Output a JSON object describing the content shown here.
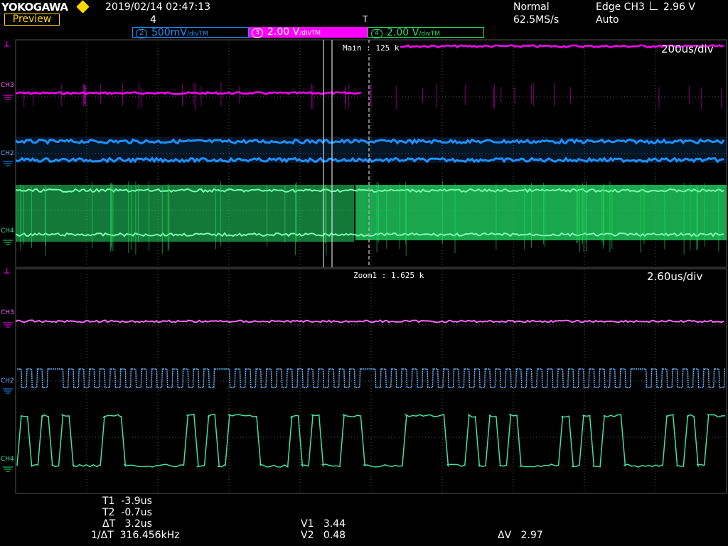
{
  "header": {
    "brand": "YOKOGAWA",
    "preview_label": "Preview",
    "datetime": "2019/02/14 02:47:13",
    "record_number": "4",
    "trigger_mode": "Normal",
    "sample_rate": "62.5MS/s",
    "trigger_type": "Edge CH3",
    "trigger_level": "2.96 V",
    "trigger_auto": "Auto",
    "trigger_marker": "T"
  },
  "channels": {
    "ch2": {
      "num": "2",
      "scale": "500mV",
      "unit": "/div",
      "suffix": "TM"
    },
    "ch3": {
      "num": "3",
      "scale": "2.00 V",
      "unit": "/div",
      "suffix": "TM"
    },
    "ch4": {
      "num": "4",
      "scale": "2.00 V",
      "unit": "/div",
      "suffix": "TM"
    }
  },
  "main_window": {
    "label": "Main : 125 k",
    "timebase": "200us/div",
    "trace_labels": [
      "CH3",
      "CH2",
      "CH4"
    ]
  },
  "zoom_window": {
    "label": "Zoom1 : 1.625 k",
    "timebase": "2.60us/div",
    "trace_labels": [
      "CH3",
      "CH2",
      "CH4"
    ]
  },
  "measurements": {
    "t1_label": "T1",
    "t1_value": "-3.9us",
    "t2_label": "T2",
    "t2_value": "-0.7us",
    "dt_label": "ΔT",
    "dt_value": "3.2us",
    "inv_dt_label": "1/ΔT",
    "inv_dt_value": "316.456kHz",
    "v1_label": "V1",
    "v1_value": "3.44",
    "v2_label": "V2",
    "v2_value": "0.48",
    "dv_label": "ΔV",
    "dv_value": "2.97"
  },
  "colors": {
    "ch2": "#1e90ff",
    "ch2_zoom": "#66b8ff",
    "ch3": "#ff00ff",
    "ch3_zoom": "#ff66ff",
    "ch4": "#22dd66",
    "ch4_zoom": "#44e0a0",
    "grid": "#555555",
    "header_accent": "#ffd700"
  },
  "zoom_ch4_bits": [
    1,
    0,
    1,
    0,
    1,
    0,
    0,
    0,
    1,
    1,
    0,
    0,
    0,
    0,
    0,
    0,
    1,
    0,
    1,
    0,
    1,
    1,
    1,
    0,
    0,
    0,
    1,
    0,
    1,
    0,
    0,
    1,
    1,
    0,
    0,
    0,
    0,
    1,
    1,
    1,
    1,
    0,
    0,
    1,
    0,
    1,
    0,
    1,
    0,
    0,
    0,
    0,
    1,
    0,
    1,
    0,
    1,
    1,
    0,
    0,
    0,
    0,
    1,
    0,
    1,
    0,
    1,
    1
  ],
  "zoom_ch2_gaps": [
    3,
    19,
    33,
    59
  ]
}
